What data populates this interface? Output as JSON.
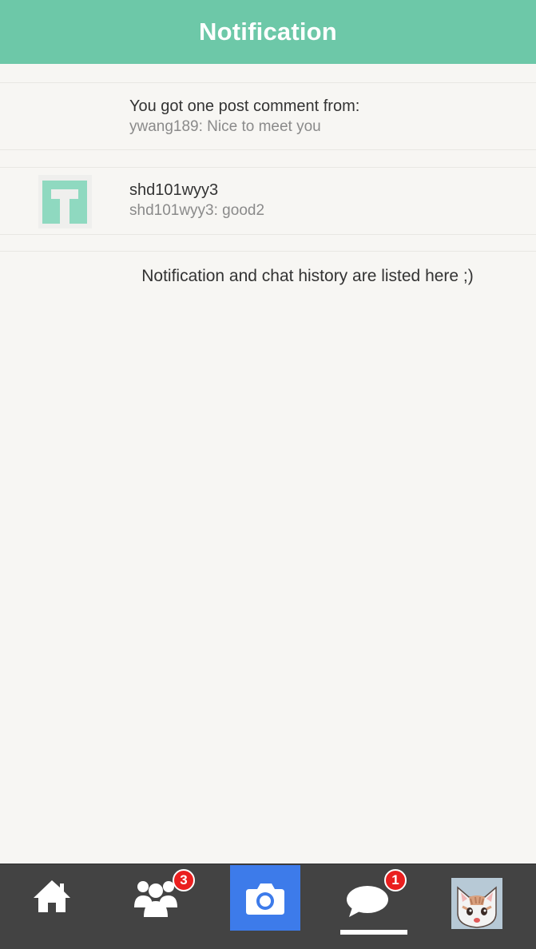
{
  "header": {
    "title": "Notification"
  },
  "notifications": [
    {
      "title": "You got one post comment from:",
      "subtitle": "ywang189: Nice to meet you",
      "avatar": null
    },
    {
      "title": "shd101wyy3",
      "subtitle": "shd101wyy3: good2",
      "avatar": "teal-identicon"
    }
  ],
  "info_text": "Notification and chat history are listed here ;)",
  "tabbar": {
    "items": [
      {
        "icon": "home-icon"
      },
      {
        "icon": "friends-icon",
        "badge": "3"
      },
      {
        "icon": "camera-icon"
      },
      {
        "icon": "chat-icon",
        "badge": "1",
        "active": true
      },
      {
        "icon": "cat-avatar"
      }
    ]
  },
  "colors": {
    "header": "#6dc8a8",
    "tabbar": "#434343",
    "camera_button": "#3d7bea",
    "badge": "#ea1f1f",
    "identicon": "#8fd9c0"
  }
}
